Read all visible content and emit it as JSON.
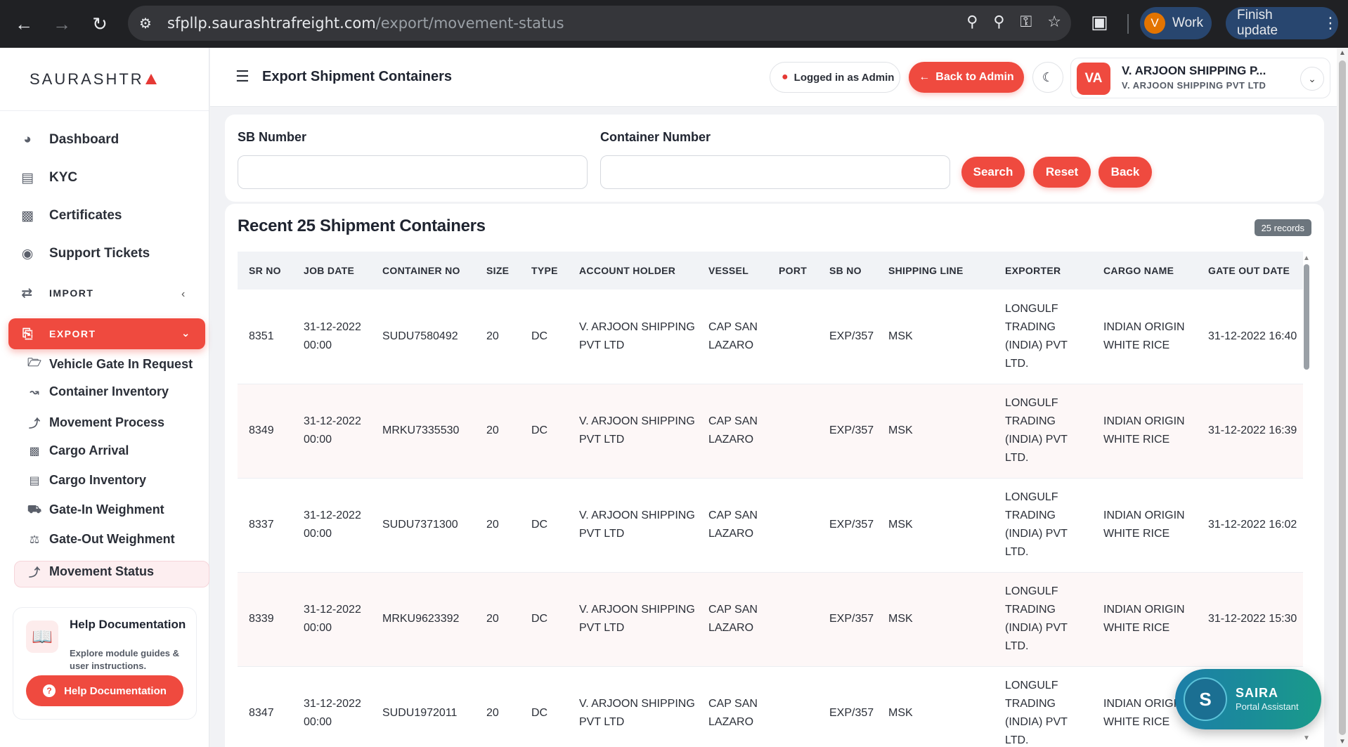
{
  "browser": {
    "url_host": "sfpllp.saurashtrafreight.com",
    "url_path": "/export/movement-status",
    "profile_initial": "V",
    "profile_label": "Work",
    "finish_update": "Finish update"
  },
  "sidebar": {
    "logo_text": "SAURASHTR",
    "main_items": [
      {
        "label": "Dashboard",
        "icon": "gauge-icon"
      },
      {
        "label": "KYC",
        "icon": "id-card-icon"
      },
      {
        "label": "Certificates",
        "icon": "certificate-icon"
      },
      {
        "label": "Support Tickets",
        "icon": "headset-icon"
      }
    ],
    "import_label": "IMPORT",
    "export_label": "EXPORT",
    "export_items": [
      {
        "label": "Vehicle Gate In Request",
        "icon": "folder-open-icon"
      },
      {
        "label": "Container Inventory",
        "icon": "chart-line-icon"
      },
      {
        "label": "Movement Process",
        "icon": "route-icon"
      },
      {
        "label": "Cargo Arrival",
        "icon": "boxes-icon"
      },
      {
        "label": "Cargo Inventory",
        "icon": "warehouse-icon"
      },
      {
        "label": "Gate-In Weighment",
        "icon": "truck-icon"
      },
      {
        "label": "Gate-Out Weighment",
        "icon": "scale-icon"
      },
      {
        "label": "Movement Status",
        "icon": "route-icon"
      }
    ],
    "help": {
      "title": "Help Documentation",
      "description": "Explore module guides & user instructions.",
      "button": "Help Documentation"
    }
  },
  "header": {
    "title": "Export Shipment Containers",
    "logged_in": "Logged in as Admin",
    "back_to_admin": "Back to Admin",
    "user_initials": "VA",
    "user_name": "V. ARJOON SHIPPING P...",
    "user_company": "V. ARJOON SHIPPING PVT LTD"
  },
  "filters": {
    "sb_label": "SB Number",
    "container_label": "Container Number",
    "sb_value": "",
    "container_value": "",
    "search": "Search",
    "reset": "Reset",
    "back": "Back"
  },
  "table": {
    "title": "Recent 25 Shipment Containers",
    "records_badge": "25 records",
    "columns": [
      "SR NO",
      "JOB DATE",
      "CONTAINER NO",
      "SIZE",
      "TYPE",
      "ACCOUNT HOLDER",
      "VESSEL",
      "PORT",
      "SB NO",
      "SHIPPING LINE",
      "EXPORTER",
      "CARGO NAME",
      "GATE OUT DATE"
    ],
    "rows": [
      [
        "8351",
        "31-12-2022 00:00",
        "SUDU7580492",
        "20",
        "DC",
        "V. ARJOON SHIPPING PVT LTD",
        "CAP SAN LAZARO",
        "",
        "EXP/357",
        "MSK",
        "LONGULF TRADING (INDIA) PVT LTD.",
        "INDIAN ORIGIN WHITE RICE",
        "31-12-2022 16:40"
      ],
      [
        "8349",
        "31-12-2022 00:00",
        "MRKU7335530",
        "20",
        "DC",
        "V. ARJOON SHIPPING PVT LTD",
        "CAP SAN LAZARO",
        "",
        "EXP/357",
        "MSK",
        "LONGULF TRADING (INDIA) PVT LTD.",
        "INDIAN ORIGIN WHITE RICE",
        "31-12-2022 16:39"
      ],
      [
        "8337",
        "31-12-2022 00:00",
        "SUDU7371300",
        "20",
        "DC",
        "V. ARJOON SHIPPING PVT LTD",
        "CAP SAN LAZARO",
        "",
        "EXP/357",
        "MSK",
        "LONGULF TRADING (INDIA) PVT LTD.",
        "INDIAN ORIGIN WHITE RICE",
        "31-12-2022 16:02"
      ],
      [
        "8339",
        "31-12-2022 00:00",
        "MRKU9623392",
        "20",
        "DC",
        "V. ARJOON SHIPPING PVT LTD",
        "CAP SAN LAZARO",
        "",
        "EXP/357",
        "MSK",
        "LONGULF TRADING (INDIA) PVT LTD.",
        "INDIAN ORIGIN WHITE RICE",
        "31-12-2022 15:30"
      ],
      [
        "8347",
        "31-12-2022 00:00",
        "SUDU1972011",
        "20",
        "DC",
        "V. ARJOON SHIPPING PVT LTD",
        "CAP SAN LAZARO",
        "",
        "EXP/357",
        "MSK",
        "LONGULF TRADING (INDIA) PVT LTD.",
        "INDIAN ORIGIN WHITE RICE",
        ""
      ]
    ]
  },
  "assistant": {
    "initial": "S",
    "name": "SAIRA",
    "role": "Portal Assistant"
  },
  "colors": {
    "accent": "#ef4a3f",
    "chrome_bg": "#202124",
    "assistant_start": "#1c7ea8",
    "assistant_end": "#199a8a"
  }
}
